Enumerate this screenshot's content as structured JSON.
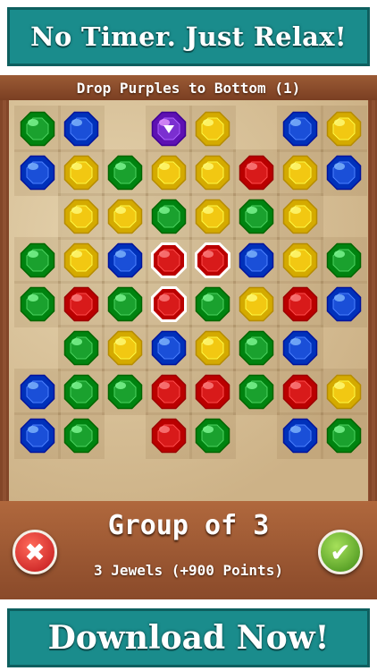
{
  "top_banner": {
    "text": "No Timer. Just Relax!"
  },
  "objective": {
    "text": "Drop Purples to Bottom (1)"
  },
  "colors": {
    "green": "#1aa12e",
    "blue": "#1a4fd8",
    "yellow": "#f2c812",
    "red": "#d81a1a",
    "purple": "#7b2fd0"
  },
  "board": {
    "rows": [
      [
        "green",
        "blue",
        null,
        "purple",
        "yellow",
        null,
        "blue",
        "yellow"
      ],
      [
        "blue",
        "yellow",
        "green",
        "yellow",
        "yellow",
        "red",
        "yellow",
        "blue"
      ],
      [
        null,
        "yellow",
        "yellow",
        "green",
        "yellow",
        "green",
        "yellow",
        null
      ],
      [
        "green",
        "yellow",
        "blue",
        "red",
        "red",
        "blue",
        "yellow",
        "green"
      ],
      [
        "green",
        "red",
        "green",
        "red",
        "green",
        "yellow",
        "red",
        "blue"
      ],
      [
        null,
        "green",
        "yellow",
        "blue",
        "yellow",
        "green",
        "blue",
        null
      ],
      [
        "blue",
        "green",
        "green",
        "red",
        "red",
        "green",
        "red",
        "yellow"
      ],
      [
        "blue",
        "green",
        null,
        "red",
        "green",
        null,
        "blue",
        "green"
      ]
    ],
    "selected": [
      [
        3,
        3
      ],
      [
        3,
        4
      ],
      [
        4,
        3
      ]
    ],
    "marked": [
      [
        0,
        3
      ]
    ]
  },
  "selection_info": {
    "title": "Group of 3",
    "detail": "3 Jewels (+900 Points)"
  },
  "buttons": {
    "cancel_icon": "x-icon",
    "confirm_icon": "check-icon"
  },
  "bottom_banner": {
    "text": "Download Now!"
  }
}
